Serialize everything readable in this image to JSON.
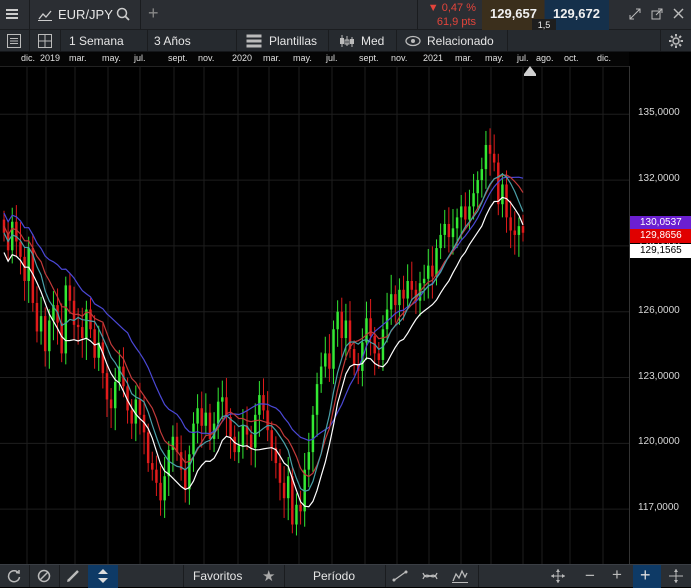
{
  "header": {
    "symbol": "EUR/JPY",
    "change_pct": "▼ 0,47 %",
    "change_pts": "61,9 pts",
    "bid": "129,657",
    "ask": "129,672",
    "spread": "1,5"
  },
  "toolbar": {
    "range1": "1 Semana",
    "range2": "3 Años",
    "templates": "Plantillas",
    "price_type": "Med",
    "related": "Relacionado"
  },
  "month_axis": [
    {
      "label": "dic.",
      "x": 21
    },
    {
      "label": "2019",
      "x": 40
    },
    {
      "label": "mar.",
      "x": 69
    },
    {
      "label": "may.",
      "x": 102
    },
    {
      "label": "jul.",
      "x": 134
    },
    {
      "label": "sept.",
      "x": 168
    },
    {
      "label": "nov.",
      "x": 198
    },
    {
      "label": "2020",
      "x": 232
    },
    {
      "label": "mar.",
      "x": 263
    },
    {
      "label": "may.",
      "x": 293
    },
    {
      "label": "jul.",
      "x": 326
    },
    {
      "label": "sept.",
      "x": 359
    },
    {
      "label": "nov.",
      "x": 391
    },
    {
      "label": "2021",
      "x": 423
    },
    {
      "label": "mar.",
      "x": 455
    },
    {
      "label": "may.",
      "x": 485
    },
    {
      "label": "jul.",
      "x": 517
    },
    {
      "label": "ago.",
      "x": 536
    },
    {
      "label": "oct.",
      "x": 564
    },
    {
      "label": "dic.",
      "x": 597
    }
  ],
  "price_axis": {
    "ticks": [
      "135,0000",
      "132,0000",
      "129,0000",
      "126,0000",
      "123,0000",
      "120,0000",
      "117,0000"
    ],
    "ymin": 114.5,
    "ymax": 137.2,
    "tags": [
      {
        "label": "130,0537",
        "price": 130.05,
        "color": "#6b1fd1"
      },
      {
        "label": "129,8656",
        "price": 129.47,
        "color": "#e00000"
      },
      {
        "label": "129,1565",
        "price": 128.75,
        "color": "#ffffff"
      }
    ]
  },
  "chart_data": {
    "type": "candlestick",
    "instrument": "EUR/JPY",
    "closes": [
      129.6,
      128.8,
      130.1,
      129.2,
      128.5,
      127.4,
      128.9,
      126.4,
      125.1,
      125.8,
      124.2,
      125.6,
      126.3,
      125.5,
      124.1,
      127.2,
      126.5,
      125.4,
      125.3,
      124.8,
      126.1,
      125.2,
      123.9,
      124.6,
      123.2,
      122.0,
      121.6,
      122.8,
      123.5,
      122.6,
      121.5,
      120.9,
      122.0,
      121.3,
      120.5,
      119.1,
      118.8,
      118.2,
      117.4,
      118.5,
      119.7,
      120.3,
      119.6,
      118.8,
      117.9,
      119.5,
      120.9,
      121.6,
      120.8,
      121.4,
      120.2,
      120.9,
      121.9,
      122.1,
      121.2,
      120.3,
      119.6,
      119.9,
      120.8,
      120.4,
      119.8,
      121.3,
      122.2,
      121.5,
      120.6,
      119.8,
      119.1,
      118.2,
      117.5,
      118.5,
      116.3,
      117.2,
      116.9,
      118.8,
      119.6,
      121.3,
      122.7,
      123.5,
      124.1,
      123.4,
      125.2,
      126.0,
      124.8,
      125.6,
      124.3,
      123.6,
      123.3,
      124.6,
      125.7,
      124.9,
      124.1,
      123.8,
      125.2,
      126.1,
      126.8,
      126.3,
      127.0,
      126.6,
      127.4,
      127.0,
      126.5,
      127.3,
      127.5,
      128.1,
      127.6,
      128.9,
      129.5,
      130.0,
      129.4,
      129.8,
      130.3,
      130.8,
      130.2,
      130.8,
      131.4,
      132.0,
      132.5,
      133.6,
      133.2,
      132.8,
      130.9,
      131.8,
      130.3,
      129.7,
      129.5,
      129.9,
      129.6
    ],
    "series": [
      {
        "name": "MA1",
        "color": "#4b48d6"
      },
      {
        "name": "MA2",
        "color": "#c23a3a"
      },
      {
        "name": "MA3",
        "color": "#4aa0a8"
      },
      {
        "name": "MA4",
        "color": "#ffffff"
      }
    ],
    "up_color": "#33e833",
    "down_color": "#e01b1b"
  },
  "bottom": {
    "favorites": "Favoritos",
    "period": "Período"
  }
}
